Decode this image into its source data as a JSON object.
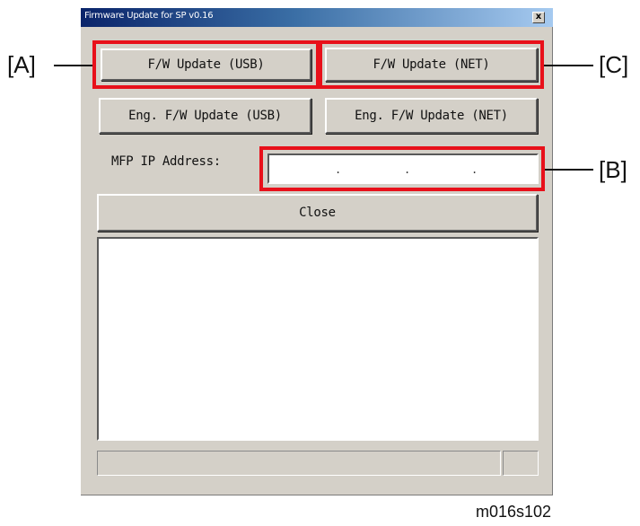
{
  "window": {
    "title": "Firmware Update for SP v0.16",
    "close_glyph": "x"
  },
  "buttons": {
    "fw_update_usb": "F/W Update (USB)",
    "fw_update_net": "F/W Update (NET)",
    "eng_fw_update_usb": "Eng. F/W Update (USB)",
    "eng_fw_update_net": "Eng. F/W Update (NET)",
    "close": "Close"
  },
  "ip_address": {
    "label": "MFP IP Address:",
    "separators": [
      ".",
      ".",
      "."
    ]
  },
  "callouts": {
    "a": "[A]",
    "b": "[B]",
    "c": "[C]"
  },
  "figure_id": "m016s102",
  "colors": {
    "highlight": "#e8101a",
    "window_face": "#d4d0c8",
    "titlebar_start": "#0a246a",
    "titlebar_end": "#a6caf0"
  },
  "icons": {
    "close": "close-icon"
  }
}
